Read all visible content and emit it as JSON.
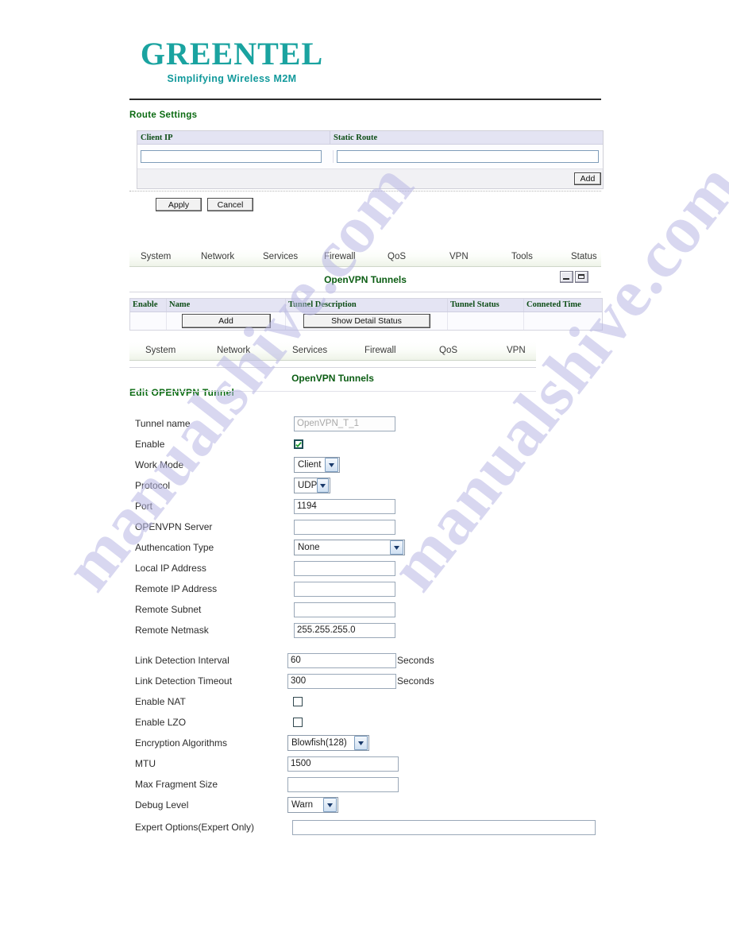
{
  "brand": {
    "name": "GREENTEL",
    "tagline": "Simplifying Wireless M2M"
  },
  "route_settings": {
    "title": "Route Settings",
    "columns": [
      "Client IP",
      "Static Route"
    ],
    "row": {
      "client_ip": "",
      "static_route": ""
    },
    "add_label": "Add",
    "apply_label": "Apply",
    "cancel_label": "Cancel"
  },
  "nav_primary": {
    "items": [
      "System",
      "Network",
      "Services",
      "Firewall",
      "QoS",
      "VPN",
      "Tools",
      "Status"
    ]
  },
  "nav_secondary": {
    "items": [
      "System",
      "Network",
      "Services",
      "Firewall",
      "QoS",
      "VPN"
    ]
  },
  "tunnels_panel": {
    "title": "OpenVPN Tunnels",
    "minimize_label": "_",
    "maximize_label": "□",
    "columns": [
      "Enable",
      "Name",
      "Tunnel Description",
      "Tunnel Status",
      "Conneted Time"
    ],
    "add_label": "Add",
    "show_detail_label": "Show Detail Status"
  },
  "edit_panel": {
    "panel_title": "OpenVPN Tunnels",
    "section_title": "Edit OPENVPN Tunnel"
  },
  "form": {
    "tunnel_name": {
      "label": "Tunnel name",
      "value": "OpenVPN_T_1"
    },
    "enable": {
      "label": "Enable",
      "checked": "true"
    },
    "work_mode": {
      "label": "Work Mode",
      "value": "Client"
    },
    "protocol": {
      "label": "Protocol",
      "value": "UDP"
    },
    "port": {
      "label": "Port",
      "value": "1194"
    },
    "openvpn_server": {
      "label": "OPENVPN Server",
      "value": ""
    },
    "auth_type": {
      "label": "Authencation Type",
      "value": "None"
    },
    "local_ip": {
      "label": "Local IP Address",
      "value": ""
    },
    "remote_ip": {
      "label": "Remote IP Address",
      "value": ""
    },
    "remote_subnet": {
      "label": "Remote Subnet",
      "value": ""
    },
    "remote_netmask": {
      "label": "Remote Netmask",
      "value": "255.255.255.0"
    },
    "link_interval": {
      "label": "Link Detection Interval",
      "value": "60",
      "unit": "Seconds"
    },
    "link_timeout": {
      "label": "Link Detection Timeout",
      "value": "300",
      "unit": "Seconds"
    },
    "enable_nat": {
      "label": "Enable NAT",
      "checked": "false"
    },
    "enable_lzo": {
      "label": "Enable LZO",
      "checked": "false"
    },
    "encryption": {
      "label": "Encryption Algorithms",
      "value": "Blowfish(128)"
    },
    "mtu": {
      "label": "MTU",
      "value": "1500"
    },
    "max_fragment": {
      "label": "Max Fragment Size",
      "value": ""
    },
    "debug_level": {
      "label": "Debug Level",
      "value": "Warn"
    },
    "expert_options": {
      "label": "Expert Options(Expert Only)",
      "value": ""
    }
  },
  "watermark": {
    "line1": "manualshive.com",
    "line2": "manualshive.com"
  },
  "colors": {
    "brand_teal": "#1aa3a0",
    "heading_green": "#0b6b12",
    "table_header_bg": "#e4e4f3"
  }
}
